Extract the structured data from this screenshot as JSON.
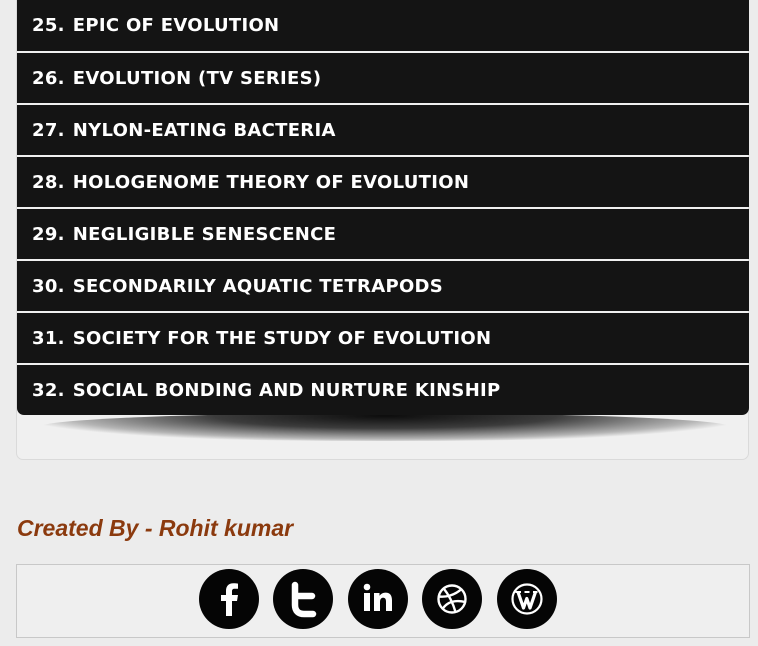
{
  "list": {
    "items": [
      {
        "num": "25.",
        "label": "EPIC OF EVOLUTION"
      },
      {
        "num": "26.",
        "label": "EVOLUTION (TV SERIES)"
      },
      {
        "num": "27.",
        "label": "NYLON-EATING BACTERIA"
      },
      {
        "num": "28.",
        "label": "HOLOGENOME THEORY OF EVOLUTION"
      },
      {
        "num": "29.",
        "label": "NEGLIGIBLE SENESCENCE"
      },
      {
        "num": "30.",
        "label": "SECONDARILY AQUATIC TETRAPODS"
      },
      {
        "num": "31.",
        "label": "SOCIETY FOR THE STUDY OF EVOLUTION"
      },
      {
        "num": "32.",
        "label": "SOCIAL BONDING AND NURTURE KINSHIP"
      }
    ]
  },
  "footer": {
    "credit": "Created By - Rohit kumar",
    "credit_color": "#8b3a0e"
  },
  "social": {
    "icons": [
      "facebook-icon",
      "twitter-icon",
      "linkedin-icon",
      "dribbble-icon",
      "wordpress-icon"
    ]
  },
  "colors": {
    "background": "#ececec",
    "list_item_bg": "#141414",
    "list_item_text": "#ffffff",
    "social_circle": "#050505"
  }
}
